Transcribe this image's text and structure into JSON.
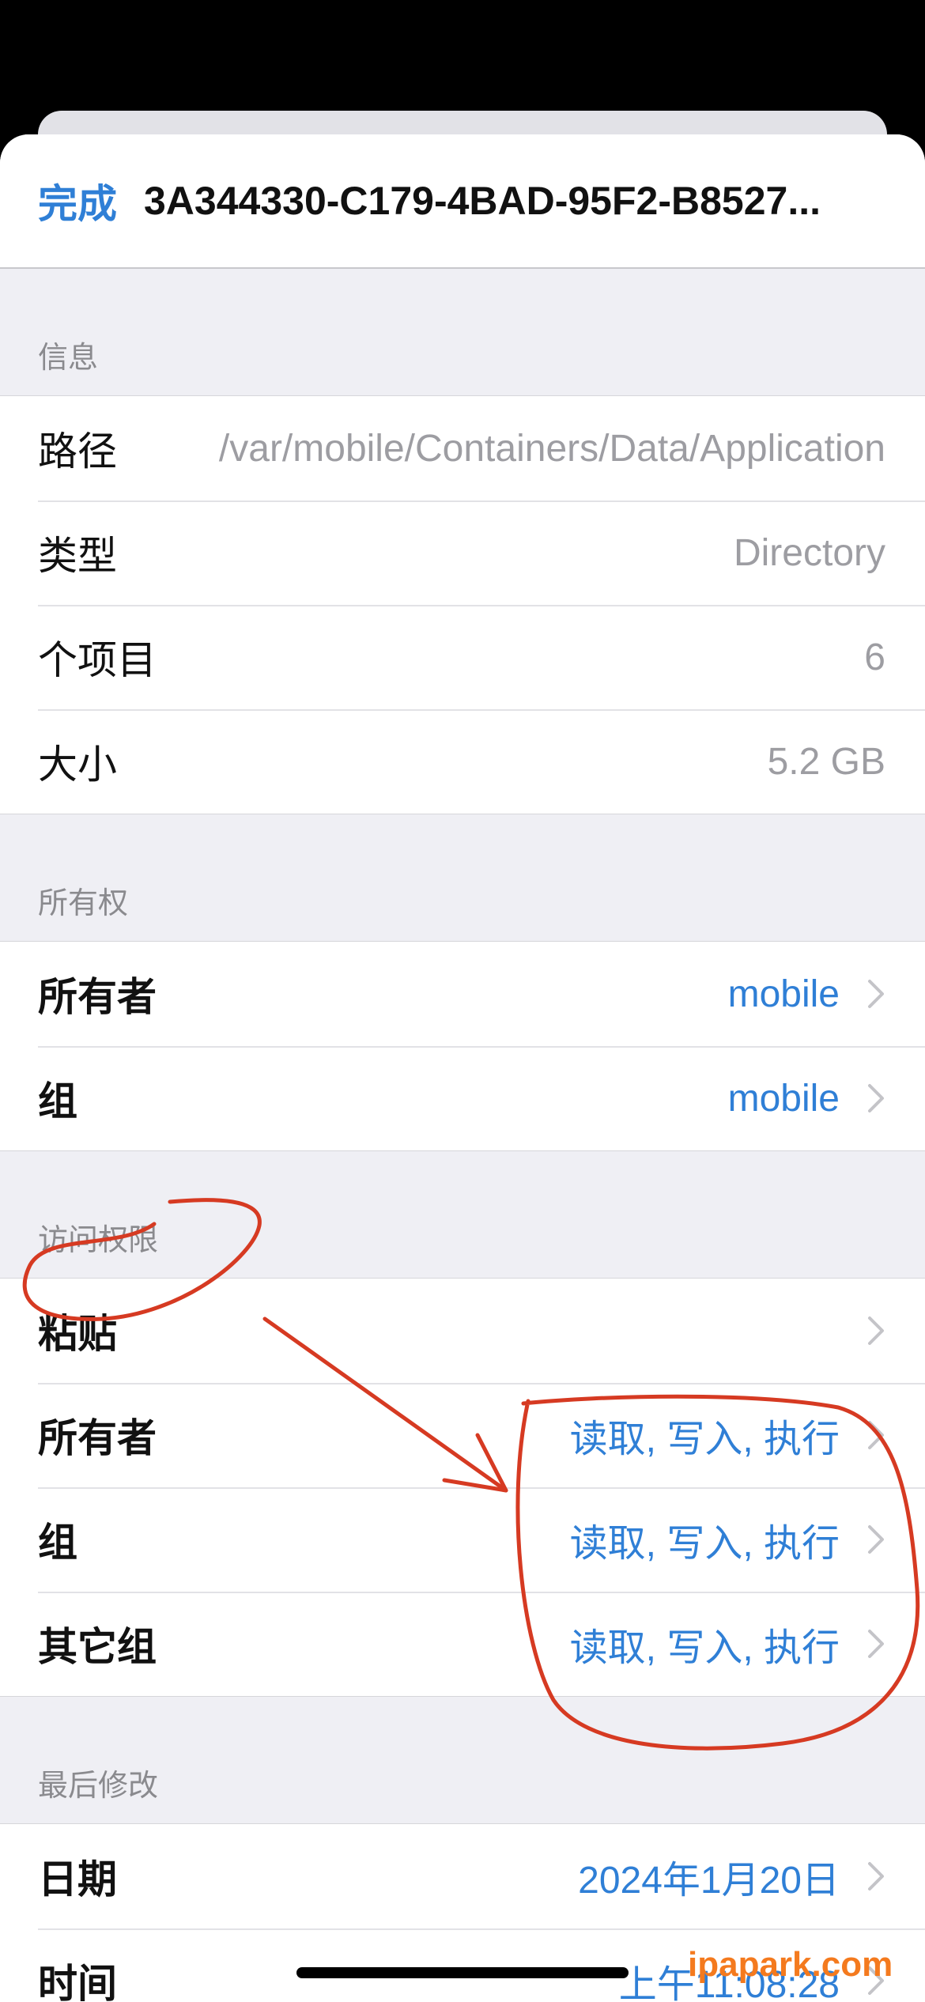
{
  "navbar": {
    "done_label": "完成",
    "title": "3A344330-C179-4BAD-95F2-B8527..."
  },
  "info": {
    "header": "信息",
    "rows": [
      {
        "label": "路径",
        "value": "/var/mobile/Containers/Data/Application"
      },
      {
        "label": "类型",
        "value": "Directory"
      },
      {
        "label": "个项目",
        "value": "6"
      },
      {
        "label": "大小",
        "value": "5.2 GB"
      }
    ]
  },
  "ownership": {
    "header": "所有权",
    "rows": [
      {
        "label": "所有者",
        "value": "mobile"
      },
      {
        "label": "组",
        "value": "mobile"
      }
    ]
  },
  "permissions": {
    "header": "访问权限",
    "rows": [
      {
        "label": "粘贴",
        "value": ""
      },
      {
        "label": "所有者",
        "value": "读取, 写入, 执行"
      },
      {
        "label": "组",
        "value": "读取, 写入, 执行"
      },
      {
        "label": "其它组",
        "value": "读取, 写入, 执行"
      }
    ]
  },
  "modified": {
    "header": "最后修改",
    "rows": [
      {
        "label": "日期",
        "value": "2024年1月20日"
      },
      {
        "label": "时间",
        "value": "上午11:08:28"
      }
    ]
  },
  "watermark": "ipapark.com",
  "colors": {
    "accent": "#2f7fd6",
    "annotation": "#d63a22",
    "background": "#efeff4",
    "watermark": "#f47a1e"
  },
  "icons": {
    "row_chevron": "chevron-right-icon"
  }
}
